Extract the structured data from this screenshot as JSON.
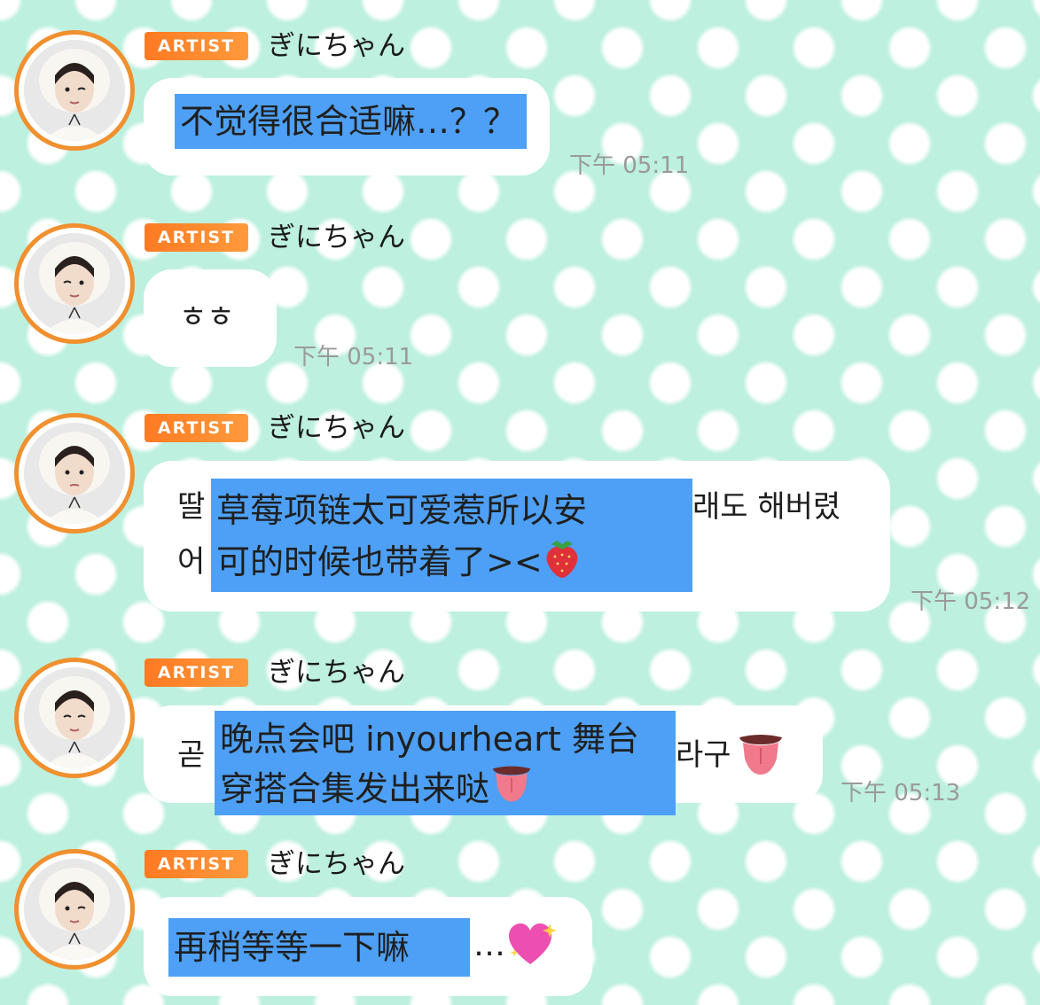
{
  "messages": [
    {
      "badge": "ARTIST",
      "name": "ぎにちゃん",
      "highlight_lines": [
        "不觉得很合适嘛…？？"
      ],
      "time": "下午 05:11"
    },
    {
      "badge": "ARTIST",
      "name": "ぎにちゃん",
      "text": "ㅎㅎ",
      "time": "下午 05:11"
    },
    {
      "badge": "ARTIST",
      "name": "ぎにちゃん",
      "korean_visible": [
        "딸",
        "래도 해버렸",
        "어"
      ],
      "highlight_lines": [
        "草莓项链太可爱惹所以安",
        "可的时候也带着了><"
      ],
      "emoji": "strawberry",
      "time": "下午 05:12"
    },
    {
      "badge": "ARTIST",
      "name": "ぎにちゃん",
      "korean_visible": [
        "곧",
        "라구"
      ],
      "highlight_lines": [
        "晚点会吧 inyourheart 舞台",
        "穿搭合集发出来哒"
      ],
      "emoji": "tongue",
      "time": "下午 05:13"
    },
    {
      "badge": "ARTIST",
      "name": "ぎにちゃん",
      "highlight_lines": [
        "再稍等等一下嘛"
      ],
      "trailing_text": "…",
      "emoji": "sparkling-heart"
    }
  ],
  "colors": {
    "background": "#bdf0de",
    "badge": "#ff8a2e",
    "highlight": "#4da0f5",
    "avatar_ring": "#f0902f"
  }
}
